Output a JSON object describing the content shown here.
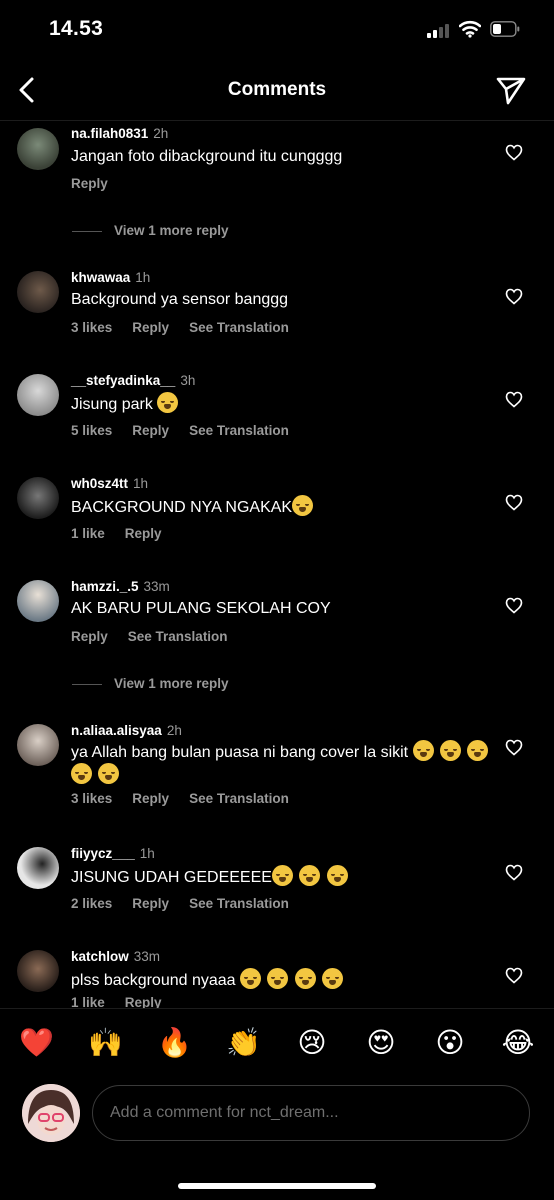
{
  "status_bar": {
    "time": "14.53"
  },
  "header": {
    "title": "Comments"
  },
  "comments": [
    {
      "username": "na.filah0831",
      "time": "2h",
      "text": "Jangan foto dibackground itu cungggg",
      "emoji_count": 0,
      "likes": "",
      "reply": "Reply",
      "see_translation": "",
      "view_more": "View 1 more reply"
    },
    {
      "username": "khwawaa",
      "time": "1h",
      "text": "Background ya sensor banggg",
      "emoji_count": 0,
      "likes": "3 likes",
      "reply": "Reply",
      "see_translation": "See Translation",
      "view_more": ""
    },
    {
      "username": "__stefyadinka__",
      "time": "3h",
      "text": "Jisung park",
      "emoji_count": 1,
      "likes": "5 likes",
      "reply": "Reply",
      "see_translation": "See Translation",
      "view_more": ""
    },
    {
      "username": "wh0sz4tt",
      "time": "1h",
      "text": "BACKGROUND NYA NGAKAK",
      "emoji_count": 1,
      "likes": "1 like",
      "reply": "Reply",
      "see_translation": "",
      "view_more": ""
    },
    {
      "username": "hamzzi._.5",
      "time": "33m",
      "text": "AK BARU PULANG SEKOLAH COY",
      "emoji_count": 0,
      "likes": "",
      "reply": "Reply",
      "see_translation": "See Translation",
      "view_more": "View 1 more reply"
    },
    {
      "username": "n.aliaa.alisyaa",
      "time": "2h",
      "text": "ya Allah bang bulan puasa ni bang cover la sikit",
      "emoji_count": 5,
      "likes": "3 likes",
      "reply": "Reply",
      "see_translation": "See Translation",
      "view_more": ""
    },
    {
      "username": "fiiyycz___",
      "time": "1h",
      "text": "JISUNG UDAH GEDEEEEE",
      "emoji_count": 3,
      "likes": "2 likes",
      "reply": "Reply",
      "see_translation": "See Translation",
      "view_more": ""
    },
    {
      "username": "katchlow",
      "time": "33m",
      "text": "plss background nyaaa",
      "emoji_count": 4,
      "likes": "1 like",
      "reply": "Reply",
      "see_translation": "",
      "view_more": ""
    }
  ],
  "reactions": [
    "❤️",
    "🙌",
    "🔥",
    "👏",
    "😢",
    "😍",
    "😮",
    "😂"
  ],
  "reaction_names": [
    "heart-emoji",
    "raising-hands-emoji",
    "fire-emoji",
    "clapping-emoji",
    "crying-emoji",
    "heart-eyes-emoji",
    "surprised-emoji",
    "laughing-emoji"
  ],
  "composer": {
    "placeholder": "Add a comment for nct_dream..."
  },
  "colors": {
    "background": "#000000",
    "secondary_text": "#9a9a9a",
    "emoji_yellow": "#f2c641"
  }
}
